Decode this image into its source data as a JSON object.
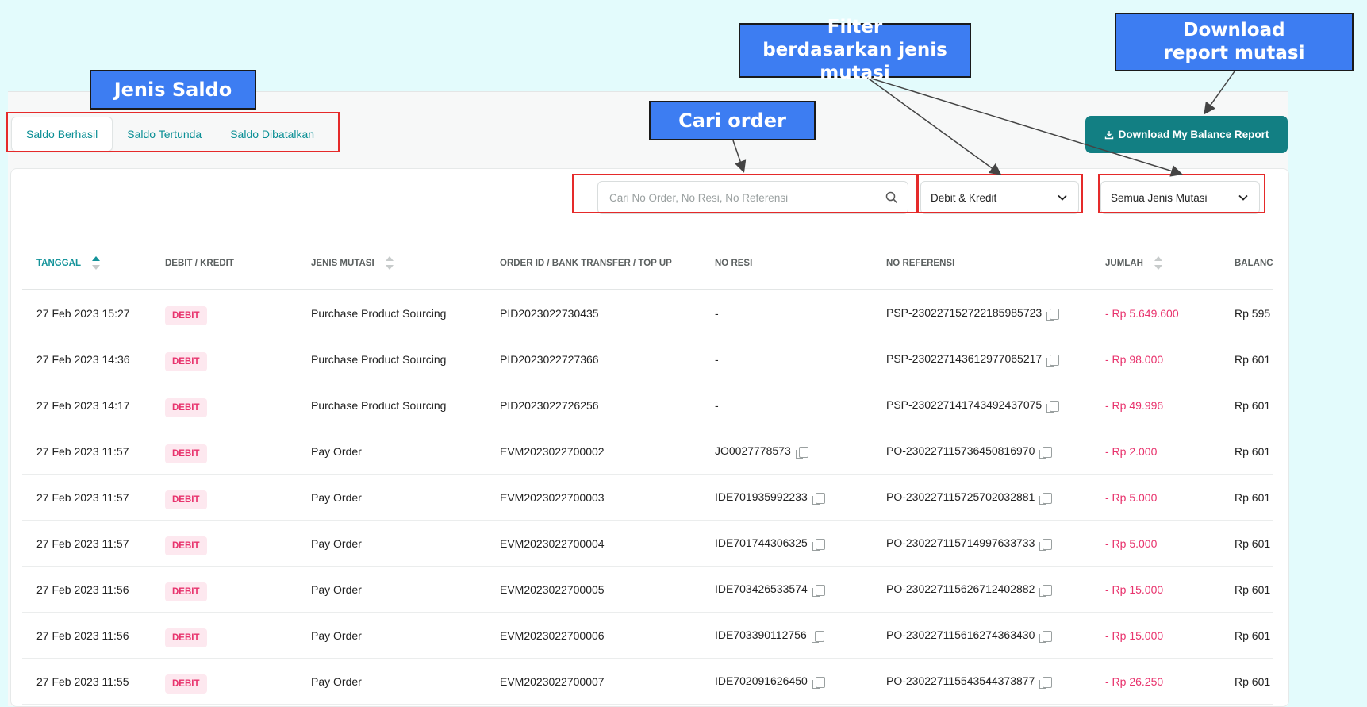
{
  "annotations": {
    "jenis_saldo": "Jenis Saldo",
    "cari_order": "Cari order",
    "filter": "Filter berdasarkan jenis mutasi",
    "download": "Download report mutasi"
  },
  "tabs": [
    {
      "label": "Saldo Berhasil",
      "active": true
    },
    {
      "label": "Saldo Tertunda",
      "active": false
    },
    {
      "label": "Saldo Dibatalkan",
      "active": false
    }
  ],
  "download_button": {
    "label": "Download My Balance Report",
    "icon": "download-icon"
  },
  "search": {
    "placeholder": "Cari No Order, No Resi, No Referensi",
    "value": "",
    "icon": "search-icon"
  },
  "filters": {
    "debit_kredit": {
      "selected": "Debit & Kredit"
    },
    "jenis_mutasi": {
      "selected": "Semua Jenis Mutasi"
    }
  },
  "table": {
    "headers": [
      "TANGGAL",
      "DEBIT / KREDIT",
      "JENIS MUTASI",
      "ORDER ID / BANK TRANSFER / TOP UP",
      "NO RESI",
      "NO REFERENSI",
      "JUMLAH",
      "BALANC"
    ],
    "rows": [
      {
        "tanggal": "27 Feb 2023 15:27",
        "type": "DEBIT",
        "jenis": "Purchase Product Sourcing",
        "order": "PID2023022730435",
        "resi": "-",
        "ref": "PSP-230227152722185985723",
        "jumlah": "- Rp 5.649.600",
        "balance": "Rp 595"
      },
      {
        "tanggal": "27 Feb 2023 14:36",
        "type": "DEBIT",
        "jenis": "Purchase Product Sourcing",
        "order": "PID2023022727366",
        "resi": "-",
        "ref": "PSP-230227143612977065217",
        "jumlah": "- Rp 98.000",
        "balance": "Rp 601"
      },
      {
        "tanggal": "27 Feb 2023 14:17",
        "type": "DEBIT",
        "jenis": "Purchase Product Sourcing",
        "order": "PID2023022726256",
        "resi": "-",
        "ref": "PSP-230227141743492437075",
        "jumlah": "- Rp 49.996",
        "balance": "Rp 601"
      },
      {
        "tanggal": "27 Feb 2023 11:57",
        "type": "DEBIT",
        "jenis": "Pay Order",
        "order": "EVM2023022700002",
        "resi": "JO0027778573",
        "ref": "PO-230227115736450816970",
        "jumlah": "- Rp 2.000",
        "balance": "Rp 601"
      },
      {
        "tanggal": "27 Feb 2023 11:57",
        "type": "DEBIT",
        "jenis": "Pay Order",
        "order": "EVM2023022700003",
        "resi": "IDE701935992233",
        "ref": "PO-230227115725702032881",
        "jumlah": "- Rp 5.000",
        "balance": "Rp 601"
      },
      {
        "tanggal": "27 Feb 2023 11:57",
        "type": "DEBIT",
        "jenis": "Pay Order",
        "order": "EVM2023022700004",
        "resi": "IDE701744306325",
        "ref": "PO-230227115714997633733",
        "jumlah": "- Rp 5.000",
        "balance": "Rp 601"
      },
      {
        "tanggal": "27 Feb 2023 11:56",
        "type": "DEBIT",
        "jenis": "Pay Order",
        "order": "EVM2023022700005",
        "resi": "IDE703426533574",
        "ref": "PO-230227115626712402882",
        "jumlah": "- Rp 15.000",
        "balance": "Rp 601"
      },
      {
        "tanggal": "27 Feb 2023 11:56",
        "type": "DEBIT",
        "jenis": "Pay Order",
        "order": "EVM2023022700006",
        "resi": "IDE703390112756",
        "ref": "PO-230227115616274363430",
        "jumlah": "- Rp 15.000",
        "balance": "Rp 601"
      },
      {
        "tanggal": "27 Feb 2023 11:55",
        "type": "DEBIT",
        "jenis": "Pay Order",
        "order": "EVM2023022700007",
        "resi": "IDE702091626450",
        "ref": "PO-230227115543544373877",
        "jumlah": "- Rp 26.250",
        "balance": "Rp 601"
      }
    ]
  },
  "colors": {
    "background": "#e3fbfc",
    "accent": "#127f83",
    "debit": "#e8336d",
    "annotation": "#3d7df2",
    "highlight": "#e52a2a"
  }
}
